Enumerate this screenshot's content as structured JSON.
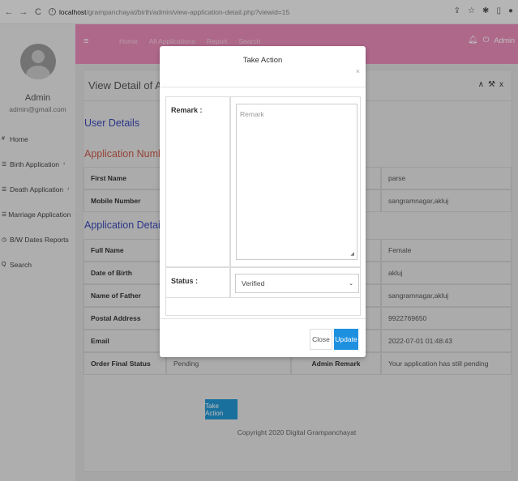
{
  "browser": {
    "back_icon": "back-arrow-icon",
    "url_host": "localhost",
    "url_path": "/grampanchayat/birth/admin/view-application-detail.php?viewid=15"
  },
  "sidebar": {
    "admin_name": "Admin",
    "admin_email": "admin@gmail.com",
    "items": [
      {
        "icon": "#",
        "label": "Home",
        "chevron": ""
      },
      {
        "icon": "☰",
        "label": "Birth Application",
        "chevron": "‹"
      },
      {
        "icon": "☰",
        "label": "Death Application",
        "chevron": "‹"
      },
      {
        "icon": "☰",
        "label": "Marriage Application",
        "chevron": "‹"
      },
      {
        "icon": "◷",
        "label": "B/W Dates Reports",
        "chevron": ""
      },
      {
        "icon": "Q",
        "label": "Search",
        "chevron": ""
      }
    ]
  },
  "topbar": {
    "links": [
      "Home",
      "All Applications",
      "Report",
      "Search"
    ],
    "admin_label": "Admin"
  },
  "main": {
    "page_title": "View Detail of Application",
    "user_details_title": "User Details",
    "application_number": "Application Number: 8",
    "application_details_title": "Application Details",
    "rows": [
      {
        "label": "First Name",
        "right": "parse"
      },
      {
        "label": "Mobile Number",
        "right": "sangramnagar,akluj"
      },
      {
        "label": "Full Name",
        "right": "Female"
      },
      {
        "label": "Date of Birth",
        "right": "akluj"
      },
      {
        "label": "Name of Father",
        "right": "sangramnagar,akluj"
      },
      {
        "label": "Postal Address",
        "right": "9922769650"
      },
      {
        "label": "Email",
        "right": "2022-07-01 01:48:43"
      }
    ],
    "status_row": {
      "label": "Order Final Status",
      "value": "Pending",
      "remark_label": "Admin Remark",
      "remark_value": "Your application has still pending"
    },
    "take_action_label": "Take Action",
    "footer": "Copyright 2020 Digital Grampanchayat"
  },
  "modal": {
    "title": "Take Action",
    "close_symbol": "×",
    "remark_label": "Remark :",
    "remark_placeholder": "Remark",
    "status_label": "Status :",
    "status_value": "Verified",
    "close_button": "Close",
    "update_button": "Update"
  },
  "colors": {
    "topbar": "#e88bb8",
    "primary_button": "#1e90e0",
    "section_title": "#3a49b5"
  }
}
